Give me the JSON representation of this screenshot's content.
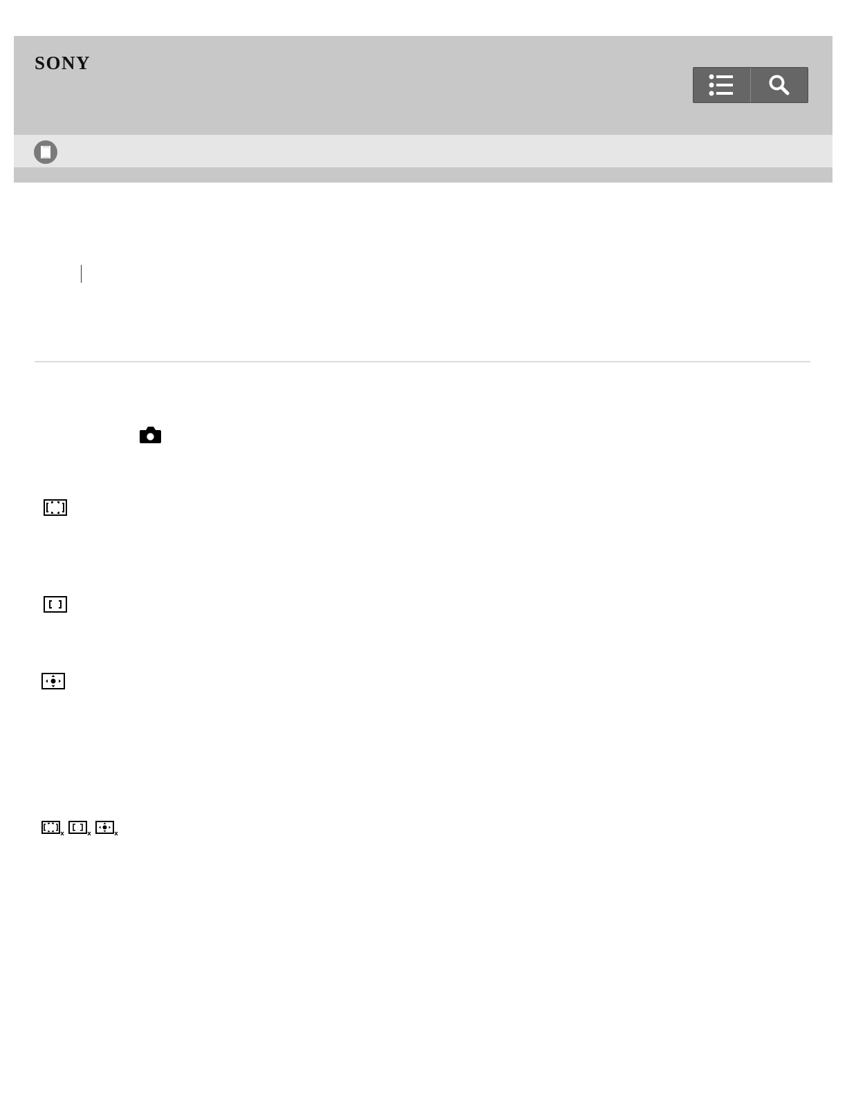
{
  "header": {
    "brand": "SONY",
    "toolbar": {
      "menu_icon": "list-icon",
      "search_icon": "search-icon"
    },
    "subbar_icon": "book-icon"
  },
  "content": {
    "icons": [
      "camera-mode-icon",
      "wide-focus-area-icon",
      "center-focus-area-icon",
      "flexible-spot-focus-icon",
      "wide-tracking-icon",
      "center-tracking-icon",
      "flexible-spot-tracking-icon"
    ]
  },
  "colors": {
    "header_bg": "#c8c8c8",
    "subbar_bg": "#e6e6e6",
    "toolbar_bg": "#666666",
    "rule": "#dcdcdc"
  }
}
